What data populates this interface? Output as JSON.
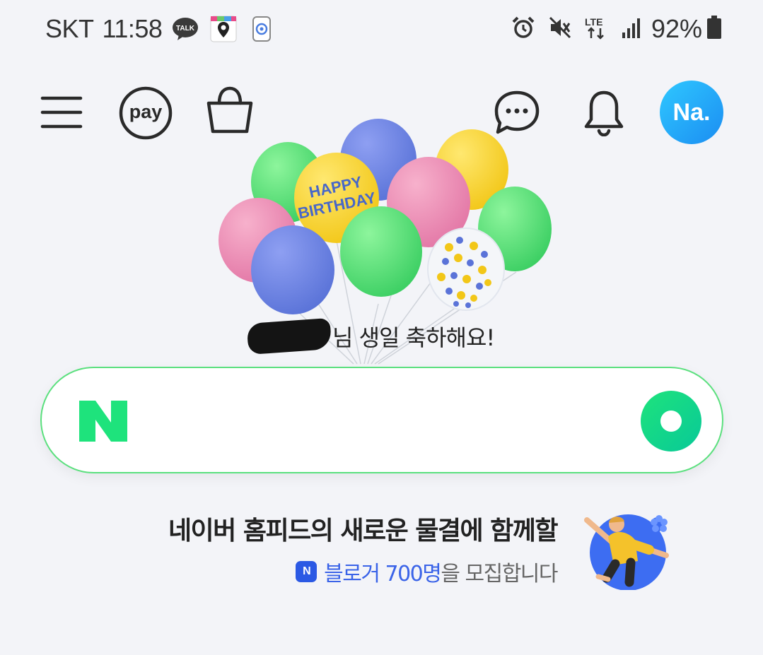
{
  "status_bar": {
    "carrier": "SKT",
    "time": "11:58",
    "notification_icons": [
      "kakaotalk-icon",
      "map-location-icon",
      "settings-app-icon"
    ],
    "system_icons": [
      "alarm-icon",
      "vibrate-mute-icon",
      "lte-icon",
      "signal-icon"
    ],
    "battery_percent": "92%"
  },
  "header": {
    "pay_label": "pay",
    "avatar_label": "Na."
  },
  "birthday": {
    "balloon_text_line1": "HAPPY",
    "balloon_text_line2": "BIRTHDAY",
    "greeting": "님 생일 축하해요!"
  },
  "search": {
    "logo_letter": "N",
    "value": "",
    "placeholder": "",
    "accent_color": "#1ee37c"
  },
  "promo": {
    "title": "네이버 홈피드의 새로운 물결에 함께할",
    "badge": "N",
    "highlight": "블로거 700명",
    "rest": "을 모집합니다"
  }
}
